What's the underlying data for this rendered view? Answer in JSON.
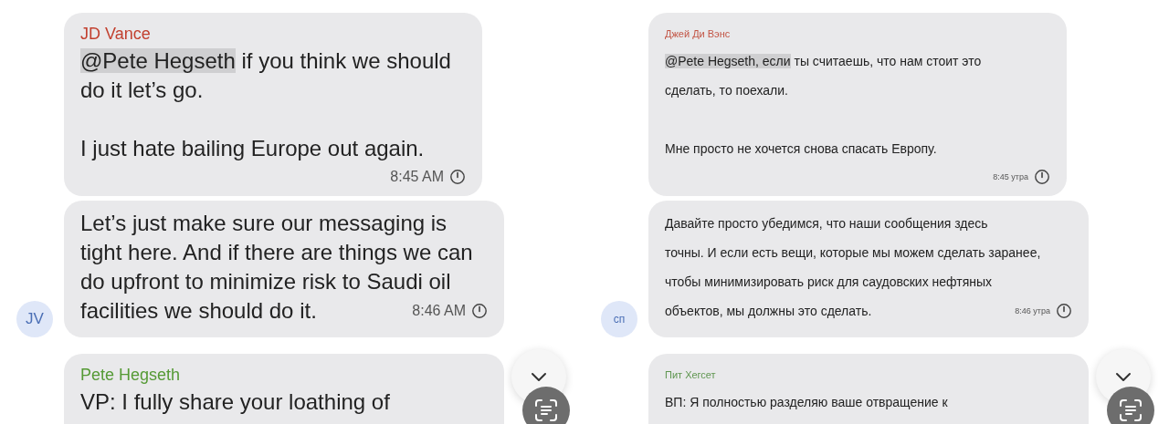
{
  "panels": [
    {
      "kind": "original",
      "messages": [
        {
          "sender": "JD Vance",
          "color": "#c2402f",
          "mention": "@Pete Hegseth",
          "paragraphs": [
            [
              " if you think we should",
              "do it let’s go."
            ],
            [
              "I just hate bailing Europe out again."
            ]
          ],
          "time": "8:45 AM",
          "time_on_own_line": true
        },
        {
          "avatar": "JV",
          "paragraphs": [
            [
              "Let’s just make sure our messaging is",
              "tight here. And if there are things we can",
              "do upfront to minimize risk to Saudi oil",
              "facilities we should do it."
            ]
          ],
          "time": "8:46 AM",
          "time_on_own_line": false
        },
        {
          "sender": "Pete Hegseth",
          "color": "#559a35",
          "paragraphs": [
            [
              "VP: I fully share your loathing of"
            ]
          ]
        }
      ]
    },
    {
      "kind": "translation",
      "messages": [
        {
          "sender": "Джей Ди Вэнс",
          "color": "#c25444",
          "mention": "@Pete Hegseth, если",
          "paragraphs": [
            [
              " ты считаешь, что нам стоит это",
              "сделать, то поехали."
            ],
            [
              "Мне просто не хочется снова спасать Европу."
            ]
          ],
          "time": "8:45 утра",
          "time_on_own_line": true
        },
        {
          "avatar": "сп",
          "paragraphs": [
            [
              "Давайте просто убедимся, что наши сообщения здесь",
              "точны. И если есть вещи, которые мы можем сделать заранее,",
              "чтобы минимизировать риск для саудовских нефтяных",
              "объектов, мы должны это сделать."
            ]
          ],
          "time": "8:46 утра",
          "time_on_own_line": false
        },
        {
          "sender": "Пит Хегсет",
          "color": "#5f9650",
          "paragraphs": [
            [
              "ВП: Я полностью разделяю ваше отвращение к"
            ]
          ]
        }
      ]
    }
  ]
}
